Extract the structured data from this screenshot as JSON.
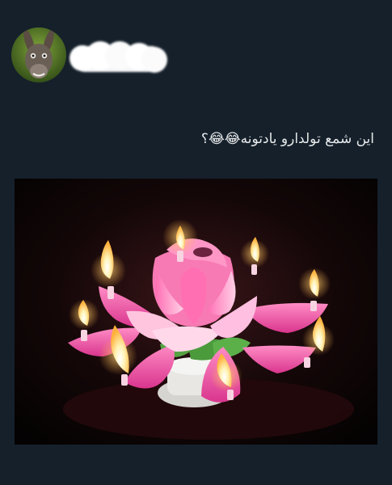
{
  "tweet": {
    "avatar_icon": "donkey-avatar",
    "display_name_redacted": true,
    "text": "این شمع تولدارو یادتونه😂😂؟",
    "media": {
      "icon": "lotus-birthday-candle-photo"
    }
  }
}
